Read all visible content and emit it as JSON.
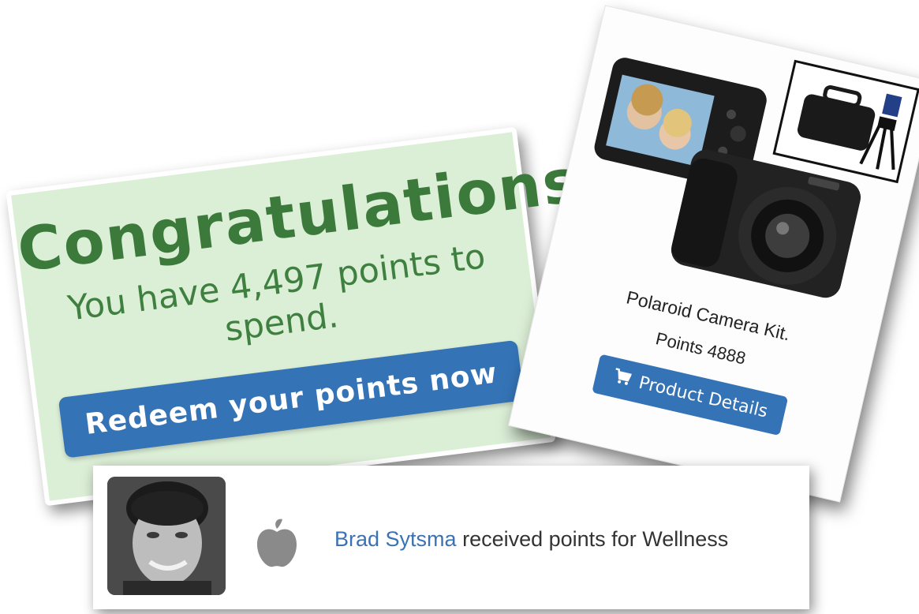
{
  "congrats": {
    "title": "Congratulations",
    "subtitle": "You have 4,497 points to spend.",
    "button_label": "Redeem your points now"
  },
  "product": {
    "name": "Polaroid Camera Kit.",
    "points": "Points 4888",
    "button_label": "Product Details",
    "button_icon": "shopping-cart-icon"
  },
  "activity": {
    "user_name": "Brad Sytsma",
    "message": "received points for Wellness",
    "category_icon": "apple-icon"
  },
  "colors": {
    "card_green": "#dbeed6",
    "text_green": "#3c7a3c",
    "button_blue": "#3473b6",
    "link_blue": "#3a72b4"
  }
}
